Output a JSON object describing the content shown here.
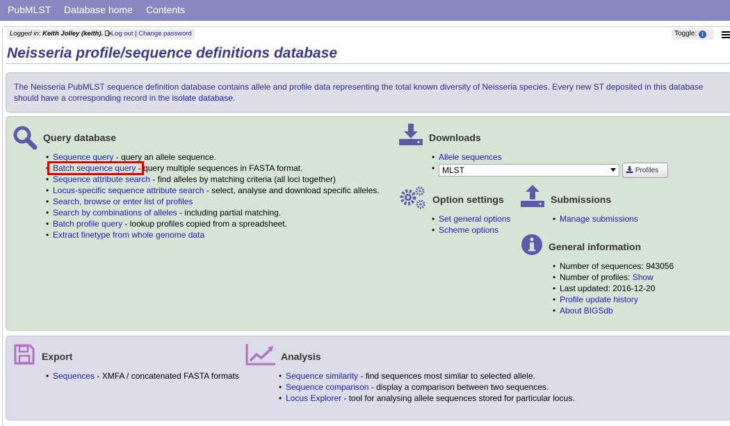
{
  "nav": {
    "items": [
      "PubMLST",
      "Database home",
      "Contents"
    ]
  },
  "session": {
    "logged_in_prefix": "Logged in: ",
    "user": "Keith Jolley (keith).",
    "logout": "Log out",
    "separator": " | ",
    "change_password": "Change password",
    "toggle_label": "Toggle: "
  },
  "page": {
    "title": "Neisseria profile/sequence definitions database",
    "intro_prefix": "The Neisseria PubMLST sequence definition database contains allele and profile data representing the total known diversity of Neisseria species. Every new ST deposited in this database should have a corresponding record in the ",
    "intro_link": "isolate database",
    "intro_suffix": "."
  },
  "query": {
    "heading": "Query database",
    "items": [
      {
        "link": "Sequence query",
        "text": " - query an allele sequence."
      },
      {
        "link": "Batch sequence query",
        "text": " - query multiple sequences in FASTA format."
      },
      {
        "link": "Sequence attribute search",
        "text": " - find alleles by matching criteria (all loci together)"
      },
      {
        "link": "Locus-specific sequence attribute search",
        "text": " - select, analyse and download specific alleles."
      },
      {
        "link": "Search, browse or enter list of profiles",
        "text": ""
      },
      {
        "link": "Search by combinations of alleles",
        "text": " - including partial matching."
      },
      {
        "link": "Batch profile query",
        "text": " - lookup profiles copied from a spreadsheet."
      },
      {
        "link": "Extract finetype from whole genome data",
        "text": ""
      }
    ]
  },
  "downloads": {
    "heading": "Downloads",
    "allele_sequences": "Allele sequences",
    "scheme_selected": "MLST",
    "profiles_button": "Profiles"
  },
  "options": {
    "heading": "Option settings",
    "items": [
      "Set general options",
      "Scheme options"
    ]
  },
  "submissions": {
    "heading": "Submissions",
    "items": [
      "Manage submissions"
    ]
  },
  "general_info": {
    "heading": "General information",
    "num_sequences_label": "Number of sequences: ",
    "num_sequences": "943056",
    "num_profiles_label": "Number of profiles: ",
    "num_profiles_link": "Show",
    "last_updated_label": "Last updated: ",
    "last_updated": "2016-12-20",
    "links": [
      "Profile update history",
      "About BIGSdb"
    ]
  },
  "export": {
    "heading": "Export",
    "items": [
      {
        "link": "Sequences",
        "text": " - XMFA / concatenated FASTA formats"
      }
    ]
  },
  "analysis": {
    "heading": "Analysis",
    "items": [
      {
        "link": "Sequence similarity",
        "text": " - find sequences most similar to selected allele."
      },
      {
        "link": "Sequence comparison",
        "text": " - display a comparison between two sequences."
      },
      {
        "link": "Locus Explorer",
        "text": " - tool for analysing allele sequences stored for particular locus."
      }
    ]
  },
  "colors": {
    "nav_bg": "#8888c0",
    "title": "#3a3a88",
    "link": "#1b1bb8",
    "icon": "#5a5aa8",
    "export_icon": "#b070c0",
    "highlight": "#e00000"
  }
}
